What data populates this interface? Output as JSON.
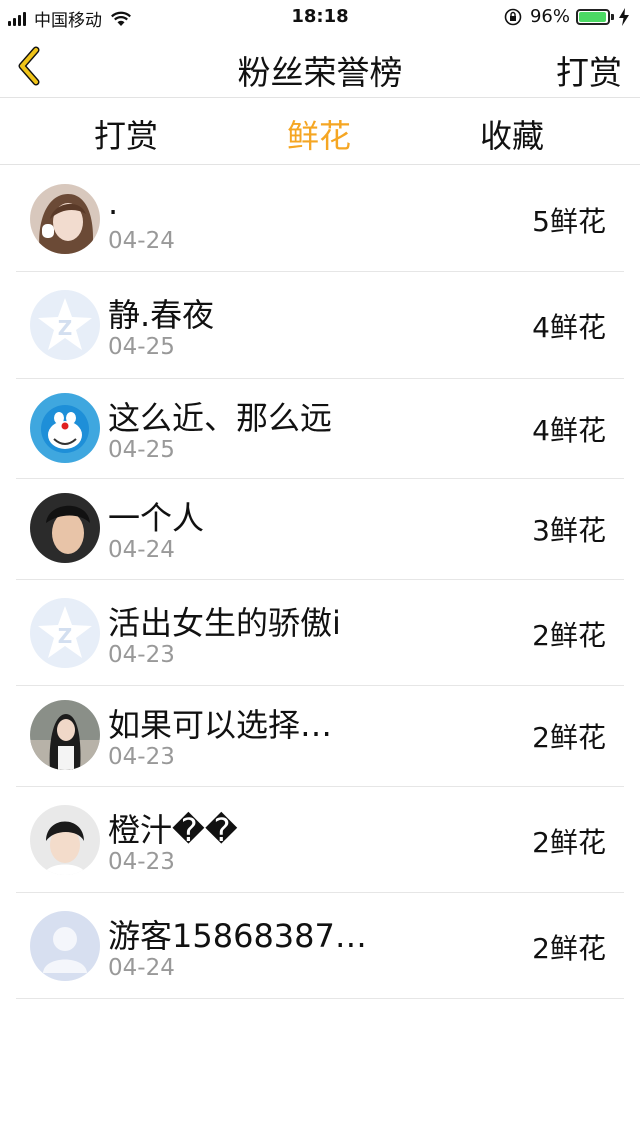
{
  "status_bar": {
    "carrier": "中国移动",
    "time": "18:18",
    "battery_percent": "96%",
    "battery_level": 0.96
  },
  "nav": {
    "title": "粉丝荣誉榜",
    "right_label": "打赏"
  },
  "tabs": [
    {
      "label": "打赏"
    },
    {
      "label": "鲜花"
    },
    {
      "label": "收藏"
    }
  ],
  "active_tab": "鲜花",
  "accent_color": "#f5a623",
  "fans": [
    {
      "name": ".",
      "date": "04-24",
      "count": "5鲜花",
      "avatar": "girl-photo-avatar"
    },
    {
      "name": "静.春夜",
      "date": "04-25",
      "count": "4鲜花",
      "avatar": "qq-default-avatar"
    },
    {
      "name": "这么近、那么远",
      "date": "04-25",
      "count": "4鲜花",
      "avatar": "doraemon-avatar"
    },
    {
      "name": "一个人",
      "date": "04-24",
      "count": "3鲜花",
      "avatar": "boy-photo-avatar"
    },
    {
      "name": "活出女生的骄傲i",
      "date": "04-23",
      "count": "2鲜花",
      "avatar": "qq-default-avatar"
    },
    {
      "name": "如果可以选择…",
      "date": "04-23",
      "count": "2鲜花",
      "avatar": "woman-photo-avatar"
    },
    {
      "name": "橙汁��",
      "date": "04-23",
      "count": "2鲜花",
      "avatar": "young-man-photo-avatar"
    },
    {
      "name": "游客15868387…",
      "date": "04-24",
      "count": "2鲜花",
      "avatar": "guest-default-avatar"
    }
  ]
}
